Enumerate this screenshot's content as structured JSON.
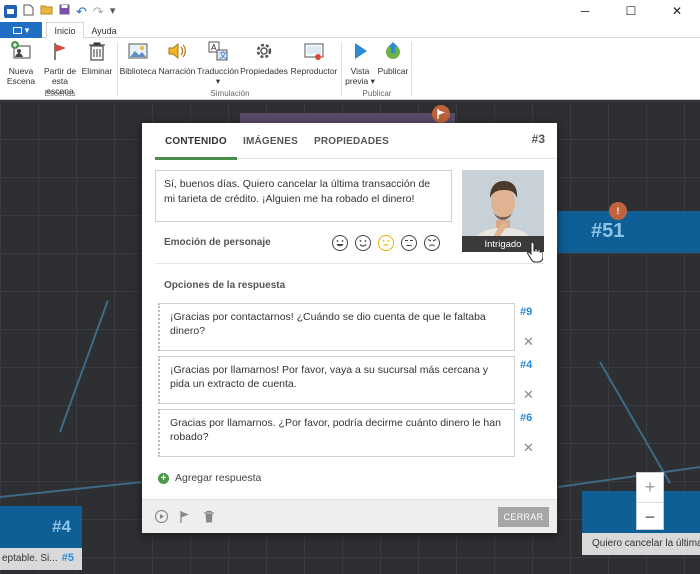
{
  "window": {
    "minimize": "─",
    "maximize": "☐",
    "close": "✕"
  },
  "quick_access": {
    "undo": "↶",
    "redo": "↷",
    "more": "▾"
  },
  "tabs": {
    "file": "▾",
    "home": "Inicio",
    "help": "Ayuda"
  },
  "ribbon": {
    "buttons": [
      {
        "label": "Nueva\nEscena"
      },
      {
        "label": "Partir de\nesta escena"
      },
      {
        "label": "Eliminar"
      },
      {
        "label": "Biblioteca"
      },
      {
        "label": "Narración"
      },
      {
        "label": "Traducción\n▾"
      },
      {
        "label": "Propiedades"
      },
      {
        "label": "Reproductor"
      },
      {
        "label": "Vista\nprevia ▾"
      },
      {
        "label": "Publicar"
      }
    ],
    "groups": {
      "scenes": "Escenas",
      "simulation": "Simulación",
      "publish": "Publicar"
    }
  },
  "canvas": {
    "node_51": "#51",
    "node_4": "#4",
    "node_5": "#5",
    "node_5_text": "eptable. Si...",
    "right_node_text": "Quiero cancelar la última tra",
    "warn_icon": "!",
    "zoom_in": "+",
    "zoom_out": "−"
  },
  "dialog": {
    "tabs": [
      "CONTENIDO",
      "IMÁGENES",
      "PROPIEDADES"
    ],
    "scene_id": "#3",
    "message": "Sí, buenos días. Quiero cancelar la última transacción de mi tarieta de crédito. ¡Alguien me ha robado el dinero!",
    "character_emotion_label": "Emoción de personaje",
    "avatar_label": "Intrigado",
    "response_options_label": "Opciones de la respuesta",
    "answers": [
      {
        "text": "¡Gracias por contactarnos! ¿Cuándo se dio cuenta de que le faltaba dinero?",
        "target": "#9"
      },
      {
        "text": "¡Gracias por llamarnos! Por favor, vaya a su sucursal más cercana y pida un extracto de cuenta.",
        "target": "#4"
      },
      {
        "text": "Gracias por llamarnos. ¿Por favor, podría decirme cuánto dinero le han robado?",
        "target": "#6"
      }
    ],
    "remove_icon": "✕",
    "add_answer": "Agregar respuesta",
    "close": "CERRAR"
  },
  "colors": {
    "accent_green": "#4a8c4a",
    "link_blue": "#2a8ad6",
    "node_blue": "#0d5f96"
  }
}
